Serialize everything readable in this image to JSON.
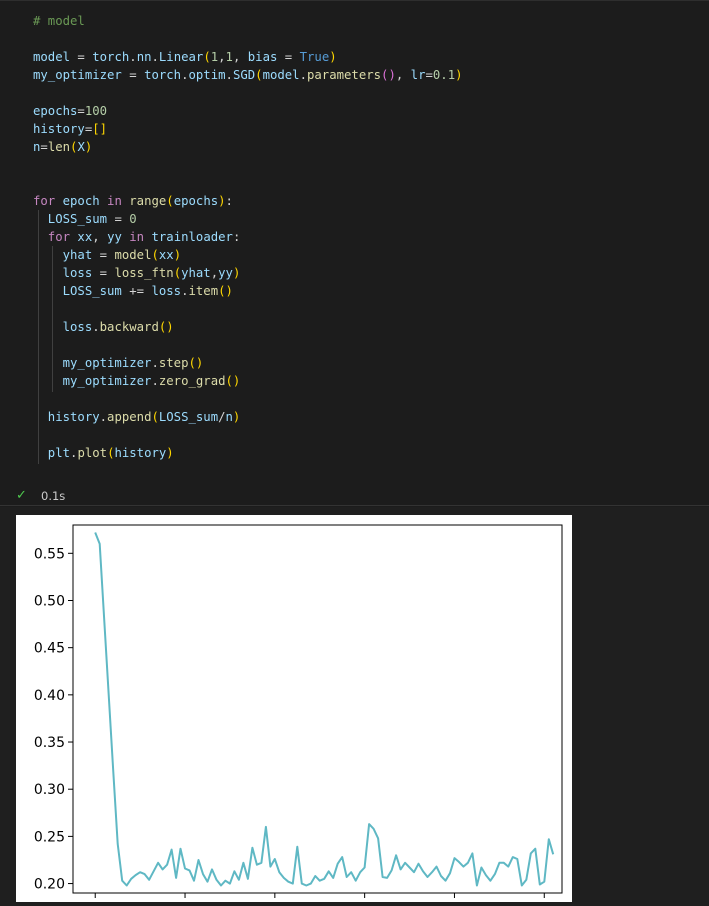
{
  "code_lines": [
    [
      {
        "t": "# model",
        "c": "tk-cm"
      }
    ],
    [],
    [
      {
        "t": "model",
        "c": "tk-var"
      },
      {
        "t": " = ",
        "c": "tk-op"
      },
      {
        "t": "torch",
        "c": "tk-var"
      },
      {
        "t": ".",
        "c": "tk-op"
      },
      {
        "t": "nn",
        "c": "tk-var"
      },
      {
        "t": ".",
        "c": "tk-op"
      },
      {
        "t": "Linear",
        "c": "tk-var"
      },
      {
        "t": "(",
        "c": "tk-y"
      },
      {
        "t": "1",
        "c": "tk-num"
      },
      {
        "t": ",",
        "c": "tk-op"
      },
      {
        "t": "1",
        "c": "tk-num"
      },
      {
        "t": ", ",
        "c": "tk-op"
      },
      {
        "t": "bias",
        "c": "tk-var"
      },
      {
        "t": " = ",
        "c": "tk-op"
      },
      {
        "t": "True",
        "c": "tk-const"
      },
      {
        "t": ")",
        "c": "tk-y"
      }
    ],
    [
      {
        "t": "my_optimizer",
        "c": "tk-var"
      },
      {
        "t": " = ",
        "c": "tk-op"
      },
      {
        "t": "torch",
        "c": "tk-var"
      },
      {
        "t": ".",
        "c": "tk-op"
      },
      {
        "t": "optim",
        "c": "tk-var"
      },
      {
        "t": ".",
        "c": "tk-op"
      },
      {
        "t": "SGD",
        "c": "tk-var"
      },
      {
        "t": "(",
        "c": "tk-y"
      },
      {
        "t": "model",
        "c": "tk-var"
      },
      {
        "t": ".",
        "c": "tk-op"
      },
      {
        "t": "parameters",
        "c": "tk-fn"
      },
      {
        "t": "()",
        "c": "tk-p"
      },
      {
        "t": ", ",
        "c": "tk-op"
      },
      {
        "t": "lr",
        "c": "tk-var"
      },
      {
        "t": "=",
        "c": "tk-op"
      },
      {
        "t": "0.1",
        "c": "tk-num"
      },
      {
        "t": ")",
        "c": "tk-y"
      }
    ],
    [],
    [
      {
        "t": "epochs",
        "c": "tk-var"
      },
      {
        "t": "=",
        "c": "tk-op"
      },
      {
        "t": "100",
        "c": "tk-num"
      }
    ],
    [
      {
        "t": "history",
        "c": "tk-var"
      },
      {
        "t": "=",
        "c": "tk-op"
      },
      {
        "t": "[]",
        "c": "tk-y"
      }
    ],
    [
      {
        "t": "n",
        "c": "tk-var"
      },
      {
        "t": "=",
        "c": "tk-op"
      },
      {
        "t": "len",
        "c": "tk-fn"
      },
      {
        "t": "(",
        "c": "tk-y"
      },
      {
        "t": "X",
        "c": "tk-var"
      },
      {
        "t": ")",
        "c": "tk-y"
      }
    ],
    [],
    [],
    [
      {
        "t": "for",
        "c": "tk-kw"
      },
      {
        "t": " epoch ",
        "c": "tk-var"
      },
      {
        "t": "in",
        "c": "tk-kw"
      },
      {
        "t": " ",
        "c": "tk-op"
      },
      {
        "t": "range",
        "c": "tk-fn"
      },
      {
        "t": "(",
        "c": "tk-y"
      },
      {
        "t": "epochs",
        "c": "tk-var"
      },
      {
        "t": ")",
        "c": "tk-y"
      },
      {
        "t": ":",
        "c": "tk-op"
      }
    ],
    [
      {
        "t": "  LOSS_sum",
        "c": "tk-var"
      },
      {
        "t": " = ",
        "c": "tk-op"
      },
      {
        "t": "0",
        "c": "tk-num"
      }
    ],
    [
      {
        "t": "  for",
        "c": "tk-kw"
      },
      {
        "t": " xx",
        "c": "tk-var"
      },
      {
        "t": ", ",
        "c": "tk-op"
      },
      {
        "t": "yy ",
        "c": "tk-var"
      },
      {
        "t": "in",
        "c": "tk-kw"
      },
      {
        "t": " trainloader",
        "c": "tk-var"
      },
      {
        "t": ":",
        "c": "tk-op"
      }
    ],
    [
      {
        "t": "    yhat",
        "c": "tk-var"
      },
      {
        "t": " = ",
        "c": "tk-op"
      },
      {
        "t": "model",
        "c": "tk-fn"
      },
      {
        "t": "(",
        "c": "tk-y"
      },
      {
        "t": "xx",
        "c": "tk-var"
      },
      {
        "t": ")",
        "c": "tk-y"
      }
    ],
    [
      {
        "t": "    loss",
        "c": "tk-var"
      },
      {
        "t": " = ",
        "c": "tk-op"
      },
      {
        "t": "loss_ftn",
        "c": "tk-fn"
      },
      {
        "t": "(",
        "c": "tk-y"
      },
      {
        "t": "yhat",
        "c": "tk-var"
      },
      {
        "t": ",",
        "c": "tk-op"
      },
      {
        "t": "yy",
        "c": "tk-var"
      },
      {
        "t": ")",
        "c": "tk-y"
      }
    ],
    [
      {
        "t": "    LOSS_sum",
        "c": "tk-var"
      },
      {
        "t": " += ",
        "c": "tk-op"
      },
      {
        "t": "loss",
        "c": "tk-var"
      },
      {
        "t": ".",
        "c": "tk-op"
      },
      {
        "t": "item",
        "c": "tk-fn"
      },
      {
        "t": "()",
        "c": "tk-y"
      }
    ],
    [],
    [
      {
        "t": "    loss",
        "c": "tk-var"
      },
      {
        "t": ".",
        "c": "tk-op"
      },
      {
        "t": "backward",
        "c": "tk-fn"
      },
      {
        "t": "()",
        "c": "tk-y"
      }
    ],
    [],
    [
      {
        "t": "    my_optimizer",
        "c": "tk-var"
      },
      {
        "t": ".",
        "c": "tk-op"
      },
      {
        "t": "step",
        "c": "tk-fn"
      },
      {
        "t": "()",
        "c": "tk-y"
      }
    ],
    [
      {
        "t": "    my_optimizer",
        "c": "tk-var"
      },
      {
        "t": ".",
        "c": "tk-op"
      },
      {
        "t": "zero_grad",
        "c": "tk-fn"
      },
      {
        "t": "()",
        "c": "tk-y"
      }
    ],
    [],
    [
      {
        "t": "  history",
        "c": "tk-var"
      },
      {
        "t": ".",
        "c": "tk-op"
      },
      {
        "t": "append",
        "c": "tk-fn"
      },
      {
        "t": "(",
        "c": "tk-y"
      },
      {
        "t": "LOSS_sum",
        "c": "tk-var"
      },
      {
        "t": "/",
        "c": "tk-op"
      },
      {
        "t": "n",
        "c": "tk-var"
      },
      {
        "t": ")",
        "c": "tk-y"
      }
    ],
    [],
    [
      {
        "t": "  plt",
        "c": "tk-var"
      },
      {
        "t": ".",
        "c": "tk-op"
      },
      {
        "t": "plot",
        "c": "tk-fn"
      },
      {
        "t": "(",
        "c": "tk-y"
      },
      {
        "t": "history",
        "c": "tk-var"
      },
      {
        "t": ")",
        "c": "tk-y"
      }
    ]
  ],
  "status": {
    "check_icon": "check-icon",
    "duration": "0.1s",
    "success_color": "#4ec94e"
  },
  "chart_data": {
    "type": "line",
    "title": "",
    "xlabel": "",
    "ylabel": "",
    "ylim": [
      0.19,
      0.58
    ],
    "xlim": [
      -4.95,
      103.95
    ],
    "ytick_labels": [
      "0.20",
      "0.25",
      "0.30",
      "0.35",
      "0.40",
      "0.45",
      "0.50",
      "0.55"
    ],
    "yticks": [
      0.2,
      0.25,
      0.3,
      0.35,
      0.4,
      0.45,
      0.5,
      0.55
    ],
    "xticks": [
      0,
      20,
      40,
      60,
      80,
      100
    ],
    "grid": false,
    "series": [
      {
        "color": "#5fb8c4",
        "values": [
          0.572,
          0.56,
          0.48,
          0.4,
          0.32,
          0.242,
          0.203,
          0.198,
          0.205,
          0.209,
          0.212,
          0.21,
          0.204,
          0.213,
          0.222,
          0.215,
          0.22,
          0.236,
          0.206,
          0.237,
          0.216,
          0.214,
          0.203,
          0.225,
          0.21,
          0.202,
          0.215,
          0.204,
          0.198,
          0.203,
          0.2,
          0.213,
          0.204,
          0.222,
          0.205,
          0.238,
          0.22,
          0.222,
          0.26,
          0.218,
          0.226,
          0.212,
          0.206,
          0.202,
          0.2,
          0.239,
          0.2,
          0.198,
          0.2,
          0.208,
          0.203,
          0.205,
          0.213,
          0.206,
          0.221,
          0.228,
          0.207,
          0.212,
          0.203,
          0.212,
          0.217,
          0.263,
          0.258,
          0.248,
          0.207,
          0.206,
          0.214,
          0.23,
          0.215,
          0.222,
          0.217,
          0.212,
          0.221,
          0.213,
          0.207,
          0.212,
          0.218,
          0.208,
          0.203,
          0.211,
          0.227,
          0.223,
          0.218,
          0.222,
          0.232,
          0.198,
          0.217,
          0.209,
          0.203,
          0.21,
          0.222,
          0.222,
          0.218,
          0.228,
          0.226,
          0.198,
          0.204,
          0.232,
          0.237,
          0.199,
          0.202,
          0.247,
          0.231
        ]
      }
    ]
  }
}
